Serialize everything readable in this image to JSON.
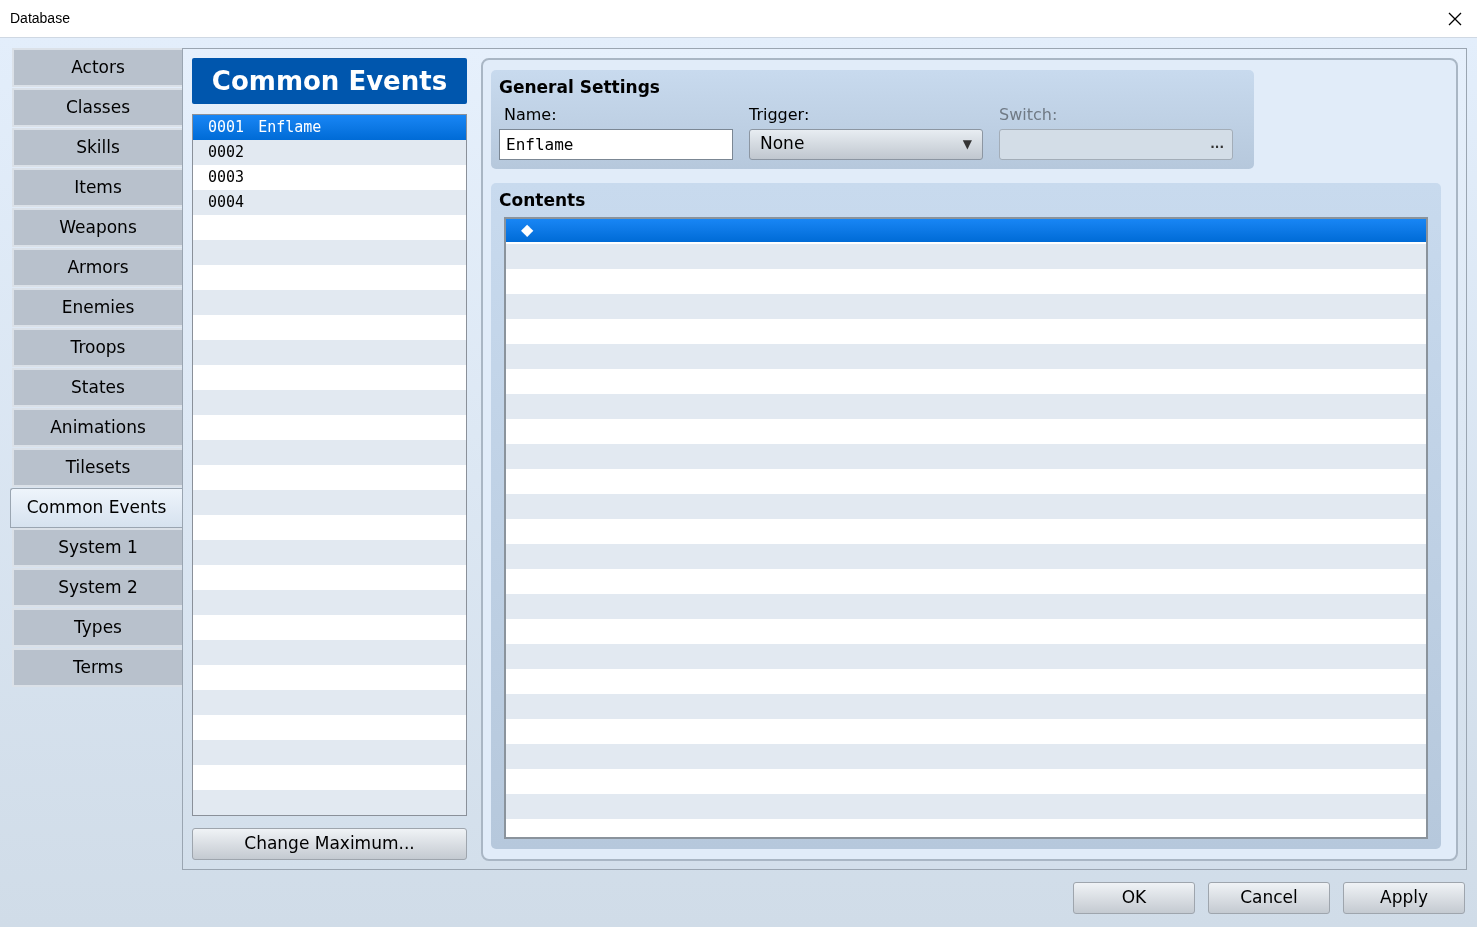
{
  "window": {
    "title": "Database"
  },
  "tabs": [
    {
      "label": "Actors",
      "selected": false
    },
    {
      "label": "Classes",
      "selected": false
    },
    {
      "label": "Skills",
      "selected": false
    },
    {
      "label": "Items",
      "selected": false
    },
    {
      "label": "Weapons",
      "selected": false
    },
    {
      "label": "Armors",
      "selected": false
    },
    {
      "label": "Enemies",
      "selected": false
    },
    {
      "label": "Troops",
      "selected": false
    },
    {
      "label": "States",
      "selected": false
    },
    {
      "label": "Animations",
      "selected": false
    },
    {
      "label": "Tilesets",
      "selected": false
    },
    {
      "label": "Common Events",
      "selected": true
    },
    {
      "label": "System 1",
      "selected": false
    },
    {
      "label": "System 2",
      "selected": false
    },
    {
      "label": "Types",
      "selected": false
    },
    {
      "label": "Terms",
      "selected": false
    }
  ],
  "list": {
    "title": "Common Events",
    "items": [
      {
        "number": "0001",
        "name": "Enflame",
        "selected": true
      },
      {
        "number": "0002",
        "selected": false
      },
      {
        "number": "0003",
        "selected": false
      },
      {
        "number": "0004",
        "selected": false
      }
    ],
    "button": "Change Maximum..."
  },
  "general_settings": {
    "title": "General Settings",
    "name": {
      "label": "Name:",
      "value": "Enflame"
    },
    "trigger": {
      "label": "Trigger:",
      "value": "None",
      "arrow": "▼"
    },
    "switch": {
      "label": "Switch:",
      "disabled": true,
      "button": "..."
    }
  },
  "contents": {
    "title": "Contents",
    "rows": [
      {
        "marker": "◆",
        "selected": true
      }
    ]
  },
  "buttons": [
    "OK",
    "Cancel",
    "Apply"
  ]
}
